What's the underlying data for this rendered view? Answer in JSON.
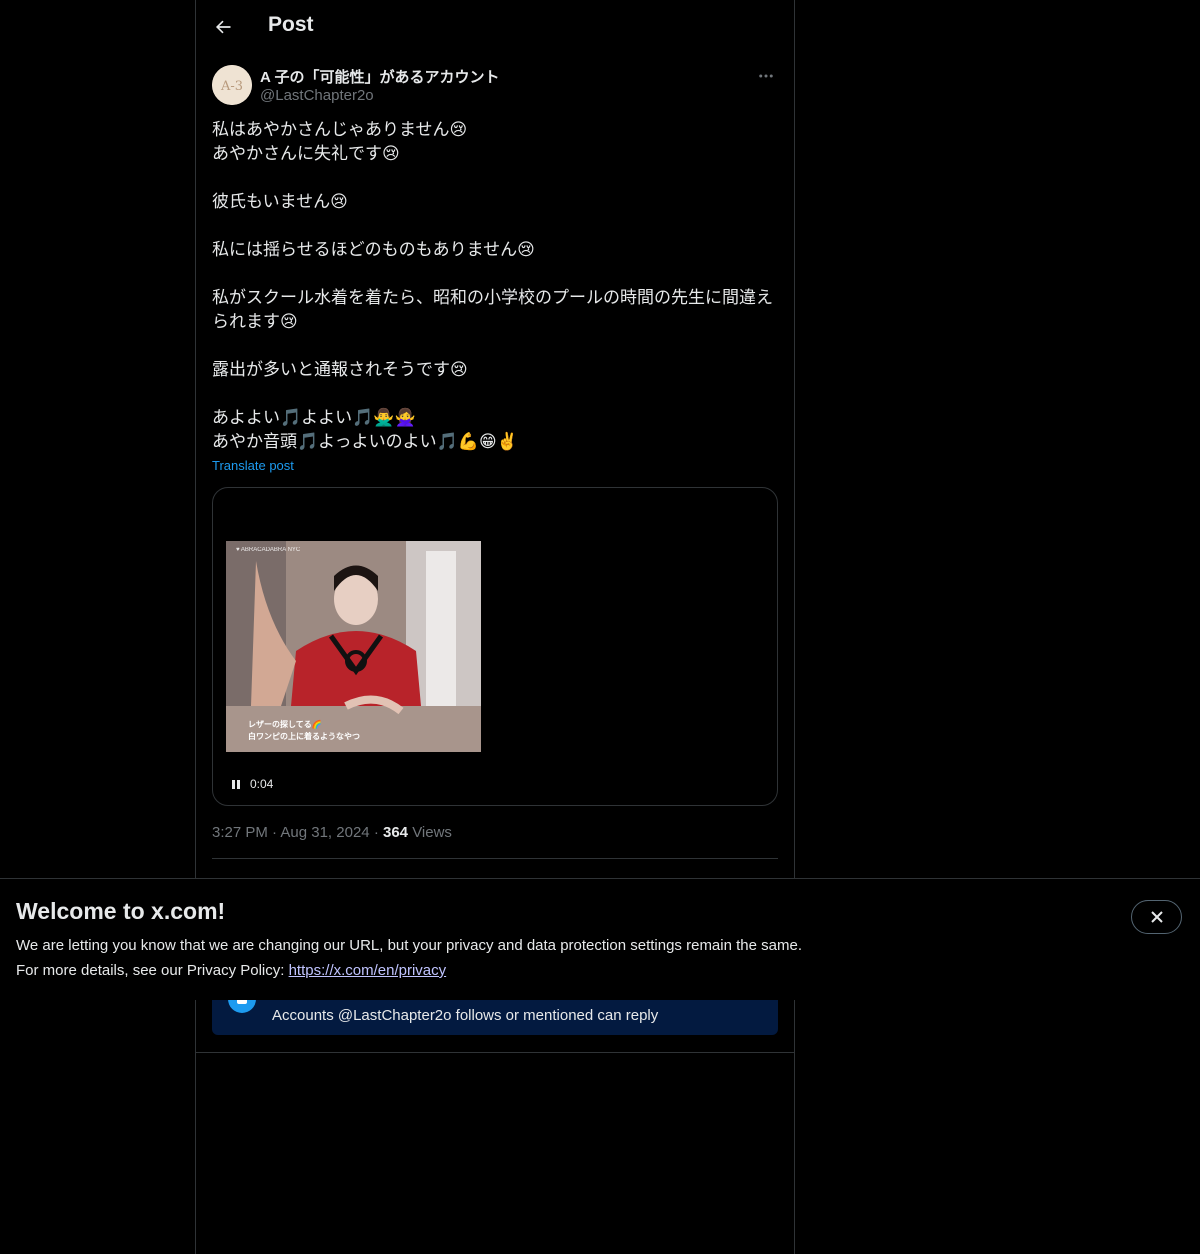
{
  "header": {
    "title": "Post"
  },
  "author": {
    "display_name": "A 子の「可能性」があるアカウント",
    "handle": "@LastChapter2o",
    "avatar_text": "A-3"
  },
  "post": {
    "lines": [
      "私はあやかさんじゃありません😢",
      "あやかさんに失礼です😢",
      "",
      "彼氏もいません😢",
      "",
      "私には揺らせるほどのものもありません😢",
      "",
      "私がスクール水着を着たら、昭和の小学校のプールの時間の先生に間違え",
      "られます😢",
      "",
      "露出が多いと通報されそうです😢",
      "",
      "あよよい🎵よよい🎵🙅‍♂️🙅‍♀️",
      "あやか音頭🎵よっよいのよい🎵💪😁✌️"
    ],
    "translate_label": "Translate post",
    "video": {
      "watermark": "♥ ABRACADABRA NYC",
      "caption_line1": "レザーの探してる🌈",
      "caption_line2": "白ワンピの上に着るようなやつ",
      "time": "0:04",
      "playing": true
    },
    "meta": {
      "time": "3:27 PM",
      "date": "Aug 31, 2024",
      "views_count": "364",
      "views_label": "Views",
      "separator": "·"
    }
  },
  "reply_restriction": {
    "text": "Accounts @LastChapter2o follows or mentioned can reply"
  },
  "banner": {
    "title": "Welcome to x.com!",
    "line1": "We are letting you know that we are changing our URL, but your privacy and data protection settings remain the same.",
    "line2_prefix": "For more details, see our Privacy Policy: ",
    "link": "https://x.com/en/privacy"
  },
  "colors": {
    "background": "#000000",
    "text": "#e7e9ea",
    "muted": "#71767b",
    "accent": "#1d9bf0",
    "border": "#2f3336"
  },
  "icons": {
    "back": "arrow-left-icon",
    "more": "ellipsis-icon",
    "pause": "pause-icon",
    "close": "close-icon",
    "reply": "at-sign-icon"
  }
}
